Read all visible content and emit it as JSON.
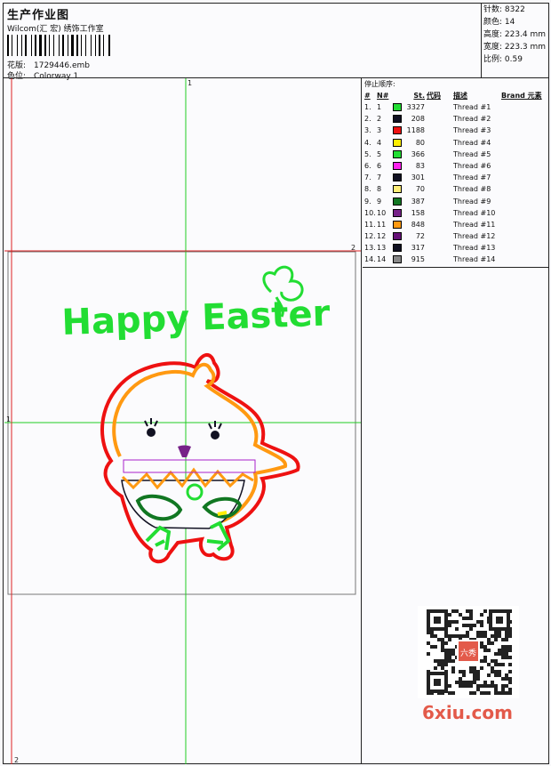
{
  "header": {
    "title": "生产作业图",
    "company": "Wilcom(汇 宏) 绣饰工作室",
    "design_label": "花版:",
    "design_value": "1729446.emb",
    "colorway_label": "色位:",
    "colorway_value": "Colorway 1"
  },
  "stats": {
    "stitches": "针数: 8322",
    "colors": "颜色: 14",
    "height": "高度: 223.4 mm",
    "width": "宽度: 223.3 mm",
    "scale": "比例: 0.59"
  },
  "threads": {
    "title": "停止顺序:",
    "headers": {
      "num": "#",
      "no": "N#",
      "st": "St.",
      "code": "代码",
      "desc": "描述",
      "brand": "Brand 元素"
    },
    "rows": [
      {
        "num": "1.",
        "no": "1",
        "color": "#22dd33",
        "st": "3327",
        "desc": "Thread #1"
      },
      {
        "num": "2.",
        "no": "2",
        "color": "#111122",
        "st": "208",
        "desc": "Thread #2"
      },
      {
        "num": "3.",
        "no": "3",
        "color": "#ee1111",
        "st": "1188",
        "desc": "Thread #3"
      },
      {
        "num": "4.",
        "no": "4",
        "color": "#ffee00",
        "st": "80",
        "desc": "Thread #4"
      },
      {
        "num": "5.",
        "no": "5",
        "color": "#22dd33",
        "st": "366",
        "desc": "Thread #5"
      },
      {
        "num": "6.",
        "no": "6",
        "color": "#ff22ee",
        "st": "83",
        "desc": "Thread #6"
      },
      {
        "num": "7.",
        "no": "7",
        "color": "#111122",
        "st": "301",
        "desc": "Thread #7"
      },
      {
        "num": "8.",
        "no": "8",
        "color": "#ffee77",
        "st": "70",
        "desc": "Thread #8"
      },
      {
        "num": "9.",
        "no": "9",
        "color": "#117722",
        "st": "387",
        "desc": "Thread #9"
      },
      {
        "num": "10.",
        "no": "10",
        "color": "#772288",
        "st": "158",
        "desc": "Thread #10"
      },
      {
        "num": "11.",
        "no": "11",
        "color": "#ff9911",
        "st": "848",
        "desc": "Thread #11"
      },
      {
        "num": "12.",
        "no": "12",
        "color": "#661177",
        "st": "72",
        "desc": "Thread #12"
      },
      {
        "num": "13.",
        "no": "13",
        "color": "#111122",
        "st": "317",
        "desc": "Thread #13"
      },
      {
        "num": "14.",
        "no": "14",
        "color": "#888888",
        "st": "915",
        "desc": "Thread #14"
      }
    ]
  },
  "design": {
    "text": "Happy Easter",
    "guide_marks": {
      "top": "1",
      "right": "2",
      "left": "1",
      "bottom": "2"
    }
  },
  "watermark": {
    "text": "6xiu.com",
    "seal": "六秀"
  },
  "colors": {
    "green": "#22dd33",
    "red": "#ee1111",
    "orange": "#ff9911",
    "guide_green": "#22cc22",
    "guide_red": "#dd2222"
  }
}
